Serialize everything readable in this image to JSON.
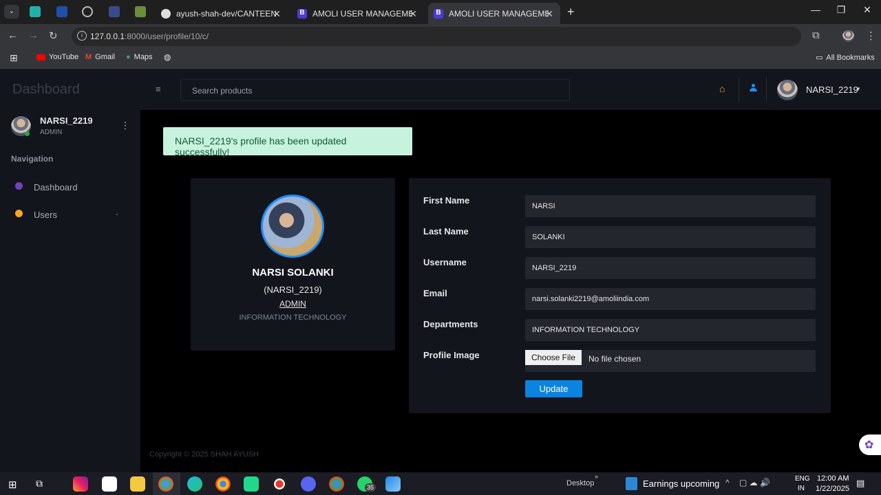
{
  "browser": {
    "tabs": [
      {
        "title": "ayush-shah-dev/CANTEEN_MA"
      },
      {
        "title": "AMOLI USER MANAGEMENT SY"
      },
      {
        "title": "AMOLI USER MANAGEMENT SY"
      }
    ],
    "url_host": "127.0.0.1",
    "url_path": ":8000/user/profile/10/c/",
    "bookmarks": [
      "YouTube",
      "Gmail",
      "Maps"
    ],
    "all_bookmarks": "All Bookmarks"
  },
  "header": {
    "brand": "Dashboard",
    "search_placeholder": "Search products",
    "username": "NARSI_2219"
  },
  "sidebar": {
    "user": {
      "name": "NARSI_2219",
      "role": "ADMIN"
    },
    "section": "Navigation",
    "items": [
      {
        "label": "Dashboard"
      },
      {
        "label": "Users"
      }
    ]
  },
  "alert": "NARSI_2219's profile has been updated successfully!",
  "profile_card": {
    "full_name": "NARSI SOLANKI",
    "username": "(NARSI_2219)",
    "role": "ADMIN",
    "department": "INFORMATION TECHNOLOGY"
  },
  "form": {
    "fields": [
      {
        "label": "First Name",
        "value": "NARSI"
      },
      {
        "label": "Last Name",
        "value": "SOLANKI"
      },
      {
        "label": "Username",
        "value": "NARSI_2219"
      },
      {
        "label": "Email",
        "value": "narsi.solanki2219@amoliindia.com"
      },
      {
        "label": "Departments",
        "value": "INFORMATION TECHNOLOGY"
      }
    ],
    "image_label": "Profile Image",
    "choose_file": "Choose File",
    "no_file": "No file chosen",
    "update": "Update"
  },
  "footer": "Copyright © 2025 SHAH AYUSH",
  "taskbar": {
    "desktop": "Desktop",
    "news": "Earnings upcoming",
    "lang": "ENG",
    "region": "IN",
    "time": "12:00 AM",
    "date": "1/22/2025",
    "whatsapp_badge": "35"
  },
  "colors": {
    "accent": "#0a84e0",
    "success_bg": "#c7f2dd",
    "success_text": "#0e5a36",
    "panel": "#13151c",
    "field": "#24262e"
  }
}
